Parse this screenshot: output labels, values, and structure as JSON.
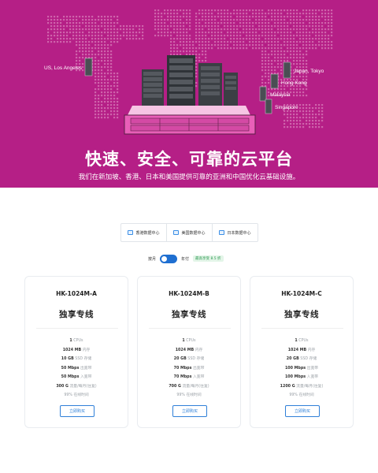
{
  "hero": {
    "title": "快速、安全、可靠的云平台",
    "subtitle": "我们在新加坡、香港、日本和美国提供可靠的亚洲和中国优化云基础设施。",
    "background_color": "#b51f86",
    "locations": [
      {
        "label": "US, Los Angeles"
      },
      {
        "label": "Japan, Tokyo"
      },
      {
        "label": "Hong Kong"
      },
      {
        "label": "Malaysia"
      },
      {
        "label": "Singapore"
      }
    ]
  },
  "datacenters": {
    "tabs": [
      {
        "label": "香港数据中心",
        "icon": "server-icon"
      },
      {
        "label": "美国数据中心",
        "icon": "server-icon"
      },
      {
        "label": "日本数据中心",
        "icon": "server-icon"
      }
    ]
  },
  "billing": {
    "monthly_label": "按月",
    "yearly_label": "年付",
    "save_badge": "最高享受 8.5 折"
  },
  "plans": [
    {
      "name": "HK-1024M-A",
      "type": "独享专线",
      "specs": [
        {
          "value": "1",
          "label": "CPUs"
        },
        {
          "value": "1024 MB",
          "label": "内存"
        },
        {
          "value": "10 GB",
          "label": "SSD 存储"
        },
        {
          "value": "50 Mbps",
          "label": "出宽带"
        },
        {
          "value": "50 Mbps",
          "label": "入宽带"
        },
        {
          "value": "300 G",
          "label": "流量/每月(往复)"
        }
      ],
      "uptime": "99% 在线时间",
      "buy_label": "立即购买"
    },
    {
      "name": "HK-1024M-B",
      "type": "独享专线",
      "specs": [
        {
          "value": "1",
          "label": "CPUs"
        },
        {
          "value": "1024 MB",
          "label": "内存"
        },
        {
          "value": "20 GB",
          "label": "SSD 存储"
        },
        {
          "value": "70 Mbps",
          "label": "出宽带"
        },
        {
          "value": "70 Mbps",
          "label": "入宽带"
        },
        {
          "value": "700 G",
          "label": "流量/每月(往复)"
        }
      ],
      "uptime": "99% 在线时间",
      "buy_label": "立即购买"
    },
    {
      "name": "HK-1024M-C",
      "type": "独享专线",
      "specs": [
        {
          "value": "1",
          "label": "CPUs"
        },
        {
          "value": "1024 MB",
          "label": "内存"
        },
        {
          "value": "20 GB",
          "label": "SSD 存储"
        },
        {
          "value": "100 Mbps",
          "label": "出宽带"
        },
        {
          "value": "100 Mbps",
          "label": "入宽带"
        },
        {
          "value": "1200 G",
          "label": "流量/每月(往复)"
        }
      ],
      "uptime": "99% 在线时间",
      "buy_label": "立即购买"
    }
  ]
}
